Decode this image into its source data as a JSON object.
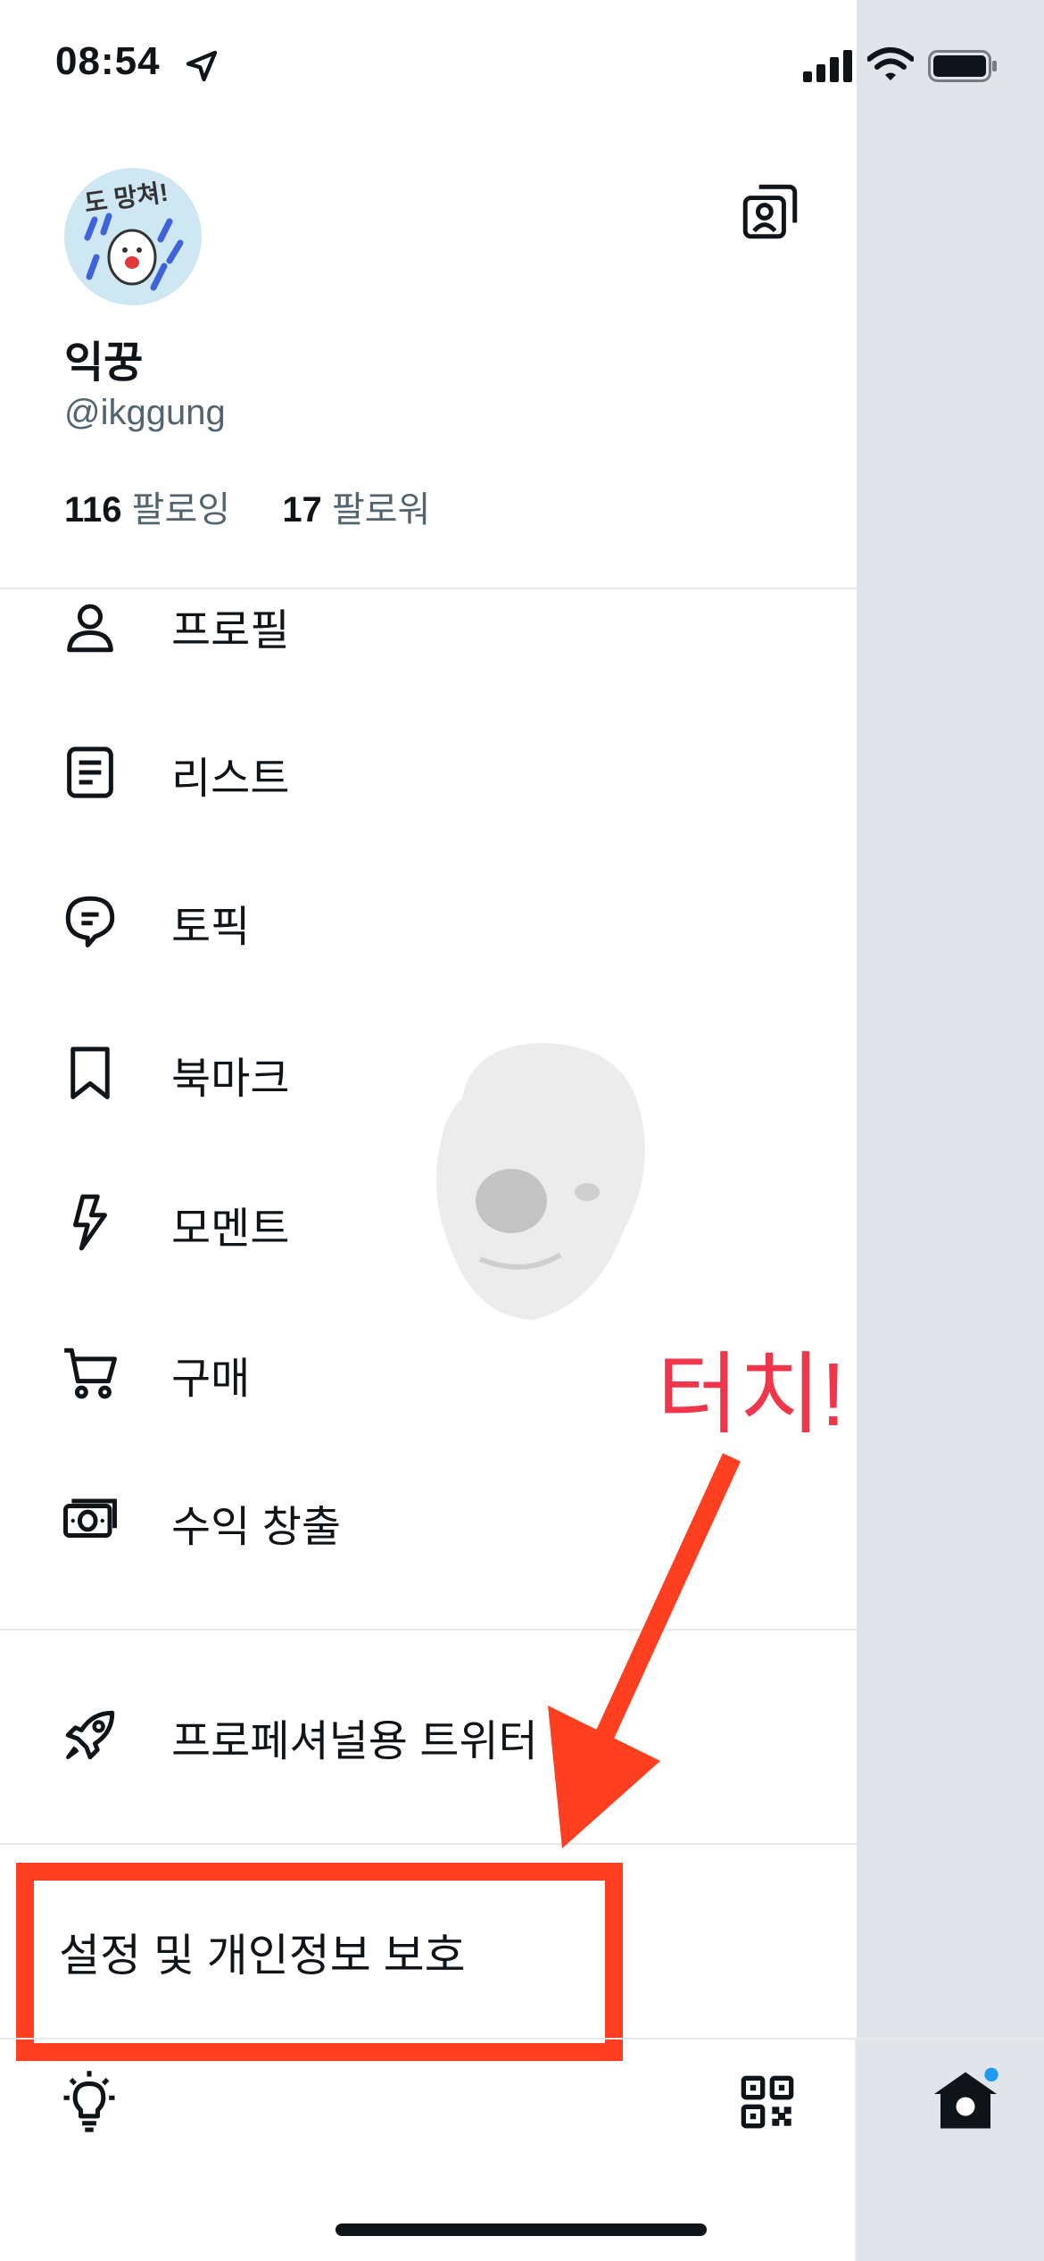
{
  "status_bar": {
    "time": "08:54"
  },
  "profile": {
    "avatar_caption": "도 망쳐!",
    "display_name": "익꿍",
    "handle": "@ikggung",
    "following_count": "116",
    "following_label": "팔로잉",
    "followers_count": "17",
    "followers_label": "팔로워"
  },
  "menu": {
    "items": [
      {
        "label": "프로필",
        "icon": "person-icon"
      },
      {
        "label": "리스트",
        "icon": "list-icon"
      },
      {
        "label": "토픽",
        "icon": "topic-icon"
      },
      {
        "label": "북마크",
        "icon": "bookmark-icon"
      },
      {
        "label": "모멘트",
        "icon": "lightning-icon"
      },
      {
        "label": "구매",
        "icon": "cart-icon"
      },
      {
        "label": "수익 창출",
        "icon": "money-icon"
      }
    ],
    "professional_label": "프로페셔널용 트위터",
    "settings_label": "설정 및 개인정보 보호"
  },
  "annotation": {
    "touch_text": "터치!",
    "color": "#f0364b",
    "box_color": "#ff3f1f"
  },
  "colors": {
    "overlay": "#e1e4e8",
    "text": "#0f1419",
    "secondary": "#536471",
    "notification_dot": "#1d9bf0"
  }
}
